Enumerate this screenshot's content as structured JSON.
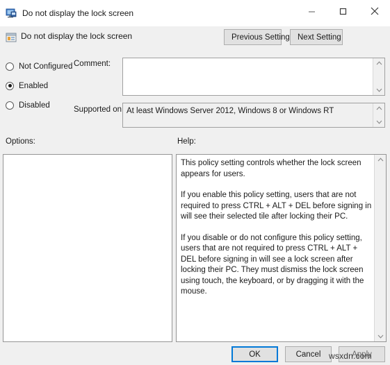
{
  "window": {
    "title": "Do not display the lock screen",
    "title_icon": "computer-monitor-icon",
    "minimize_label": "Minimize",
    "maximize_label": "Maximize",
    "close_label": "Close"
  },
  "header": {
    "title": "Do not display the lock screen",
    "icon": "policy-setting-icon",
    "previous_setting": "Previous Setting",
    "next_setting": "Next Setting"
  },
  "state": {
    "options": [
      {
        "label": "Not Configured",
        "selected": false
      },
      {
        "label": "Enabled",
        "selected": true
      },
      {
        "label": "Disabled",
        "selected": false
      }
    ]
  },
  "fields": {
    "comment_label": "Comment:",
    "comment_value": "",
    "supported_label": "Supported on:",
    "supported_value": "At least Windows Server 2012, Windows 8 or Windows RT"
  },
  "panels": {
    "options_label": "Options:",
    "options_content": "",
    "help_label": "Help:",
    "help_paragraphs": [
      "This policy setting controls whether the lock screen appears for users.",
      "If you enable this policy setting, users that are not required to press CTRL + ALT + DEL before signing in will see their selected tile after locking their PC.",
      "If you disable or do not configure this policy setting, users that are not required to press CTRL + ALT + DEL before signing in will see a lock screen after locking their PC. They must dismiss the lock screen using touch, the keyboard, or by dragging it with the mouse."
    ]
  },
  "footer": {
    "ok": "OK",
    "cancel": "Cancel",
    "apply": "Apply"
  },
  "watermark": {
    "text": "wsxdn.com"
  },
  "colors": {
    "accent": "#0078d7",
    "window_bg": "#f0f0f0",
    "panel_bg": "#ffffff",
    "border": "#949494",
    "text": "#1a1a1a"
  }
}
